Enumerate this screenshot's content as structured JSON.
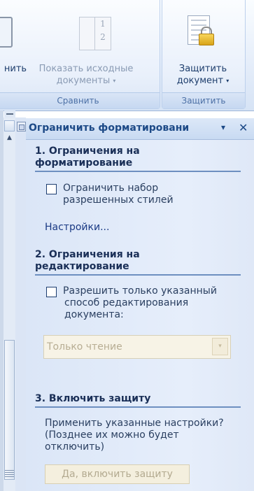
{
  "ribbon": {
    "compare_button_partial_label": "нить",
    "show_source_label_line1": "Показать исходные",
    "show_source_label_line2": "документы",
    "compare_group_label": "Сравнить",
    "protect_label_line1": "Защитить",
    "protect_label_line2": "документ",
    "protect_group_label": "Защитить",
    "two_docs_numbers": [
      "1",
      "2"
    ]
  },
  "pane": {
    "title": "Ограничить форматировани",
    "section1": {
      "title_line1": "1. Ограничения на",
      "title_line2": "форматирование",
      "checkbox_line1": "Ограничить набор",
      "checkbox_line2": "разрешенных стилей",
      "checked": false,
      "settings_link": "Настройки..."
    },
    "section2": {
      "title_line1": "2. Ограничения на",
      "title_line2": "редактирование",
      "checkbox_line1": "Разрешить только указанный",
      "checkbox_line2": "способ редактирования",
      "checkbox_line3": "документа:",
      "checked": false,
      "select_value": "Только чтение"
    },
    "section3": {
      "title": "3. Включить защиту",
      "text_line1": "Применить указанные настройки?",
      "text_line2": "(Позднее их можно будет",
      "text_line3": "отключить)",
      "button_label": "Да, включить защиту"
    }
  },
  "icons": {
    "dropdown": "▾",
    "close": "✕",
    "scroll_up": "▲"
  },
  "colors": {
    "pane_bg": "#dfe8f7",
    "title_color": "#1d4a87",
    "disabled_text": "#b7ad93"
  }
}
